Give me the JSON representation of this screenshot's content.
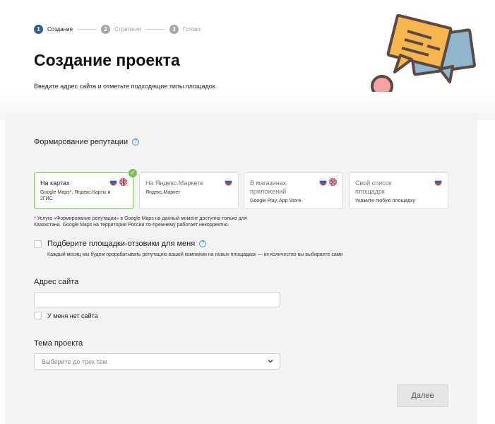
{
  "stepper": {
    "steps": [
      {
        "num": "1",
        "label": "Создание"
      },
      {
        "num": "2",
        "label": "Стратегия"
      },
      {
        "num": "3",
        "label": "Готово"
      }
    ]
  },
  "header": {
    "title": "Создание проекта",
    "subtitle": "Введите адрес сайта и отметьте подходящие типы площадок."
  },
  "reputation": {
    "title": "Формирование репутации",
    "help": "?",
    "cards": [
      {
        "title": "На картах",
        "sub": "Google Maps*, Яндекс.Карты и 2ГИС",
        "flags": [
          "ru-flag-icon",
          "uk-flag-icon"
        ],
        "selected": true
      },
      {
        "title": "На Яндекс.Маркете",
        "sub": "Яндекс.Маркет",
        "flags": [
          "ru-flag-icon"
        ],
        "selected": false
      },
      {
        "title": "В магазинах приложений",
        "sub": "Google Play, App Store",
        "flags": [
          "ru-flag-icon",
          "uk-flag-icon"
        ],
        "selected": false
      },
      {
        "title": "Свой список площадок",
        "sub": "Укажите любую площадку",
        "flags": [
          "ru-flag-icon"
        ],
        "selected": false
      }
    ],
    "note_star": "*",
    "note": " Услуга «Формирование репутации» в Google Maps на данный момент доступна только для Казахстана. Google Maps на территории России по-прежнему работает некорректно."
  },
  "pick_sites": {
    "label": "Подберите площадки-отзовики для меня",
    "help": "?",
    "desc": "Каждый месяц мы будем прорабатывать репутацию вашей компании на новых площадках — их количество вы выбираете сами",
    "checked": false
  },
  "site": {
    "label": "Адрес сайта",
    "value": "",
    "no_site_label": "У меня нет сайта"
  },
  "topic": {
    "label": "Тема проекта",
    "placeholder": "Выберите до трех тем"
  },
  "next_button": "Далее",
  "colors": {
    "accent": "#2d5f99",
    "selected_border": "#7cc05a",
    "help": "#4a8fd0",
    "panel": "#f4f4f4"
  }
}
